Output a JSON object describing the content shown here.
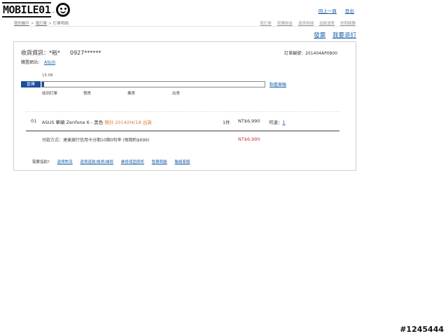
{
  "site": {
    "logo_text": "MOBILE01",
    "logo_mark": "™"
  },
  "header": {
    "links": [
      "回上一頁",
      "登出"
    ]
  },
  "breadcrumb": [
    "我的帳戶",
    "我訂單",
    "訂單明細"
  ],
  "tabs": [
    "我訂單",
    "我購物金",
    "退貨明細",
    "追蹤運寄",
    "常問疑難"
  ],
  "actions": [
    "發票",
    "我要退訂"
  ],
  "order": {
    "recipient_label": "收貨資訊：",
    "recipient_name": "*裕*",
    "phone": "0927******",
    "order_no_label": "訂單編號：",
    "order_no": "201404AP0800",
    "seller_label": "購置網站：",
    "seller": "ASUS"
  },
  "tracking": {
    "date": "15.06",
    "label": "倉庫",
    "progress_fraction": 0.01,
    "link": "點看面報",
    "steps": [
      "收到訂單",
      "預貨",
      "揀貨",
      "出貨"
    ]
  },
  "item": {
    "index": "01",
    "name": "ASUS 華碩 Zenfone 6 - 黑色",
    "eta": "預計 2014/04/18 出貨",
    "qty": "1件",
    "price": "NT$6,990",
    "status_label": "可退：",
    "status_value": "1"
  },
  "payment": {
    "text": "付款方式：達東銀行信用卡分期10期0利率 (每期約$699)",
    "total": "NT$6,990"
  },
  "help": {
    "label": "需要協助?",
    "links": [
      "退貨對流",
      "退貨退款/換貨/維修",
      "維修保固資訊",
      "發票問題",
      "聯絡客服"
    ]
  },
  "watermark": "#1245444",
  "colors": {
    "accent": "#1b4f9a",
    "link": "#1a5fa8",
    "eta": "#e07a2c",
    "price": "#cc3333"
  }
}
